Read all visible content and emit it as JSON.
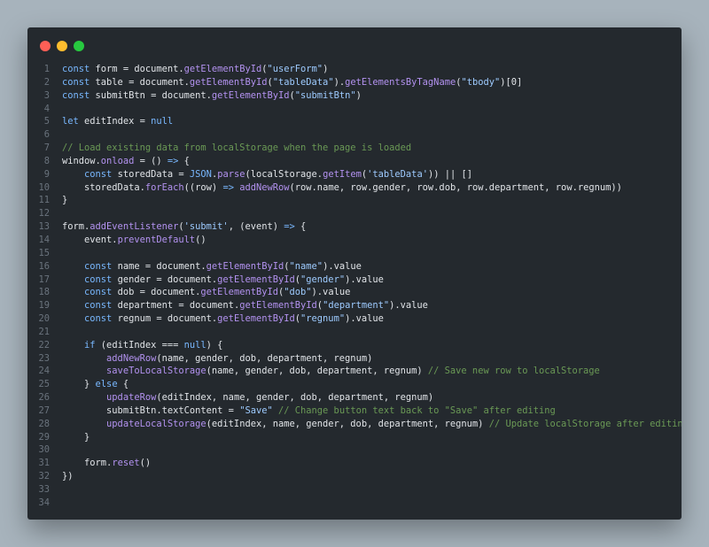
{
  "window": {
    "buttons": [
      "close",
      "minimize",
      "maximize"
    ],
    "colors": {
      "close": "#ff5f56",
      "minimize": "#ffbd2e",
      "maximize": "#27c93f",
      "background": "#24292e",
      "page_background": "#a7b3bc"
    }
  },
  "editor": {
    "language": "javascript",
    "lines": [
      [
        {
          "t": "const",
          "c": "kw"
        },
        {
          "t": " form = document.",
          "c": "pl"
        },
        {
          "t": "getElementById",
          "c": "fn"
        },
        {
          "t": "(",
          "c": "pl"
        },
        {
          "t": "\"userForm\"",
          "c": "str"
        },
        {
          "t": ")",
          "c": "pl"
        }
      ],
      [
        {
          "t": "const",
          "c": "kw"
        },
        {
          "t": " table = document.",
          "c": "pl"
        },
        {
          "t": "getElementById",
          "c": "fn"
        },
        {
          "t": "(",
          "c": "pl"
        },
        {
          "t": "\"tableData\"",
          "c": "str"
        },
        {
          "t": ").",
          "c": "pl"
        },
        {
          "t": "getElementsByTagName",
          "c": "fn"
        },
        {
          "t": "(",
          "c": "pl"
        },
        {
          "t": "\"tbody\"",
          "c": "str"
        },
        {
          "t": ")[0]",
          "c": "pl"
        }
      ],
      [
        {
          "t": "const",
          "c": "kw"
        },
        {
          "t": " submitBtn = document.",
          "c": "pl"
        },
        {
          "t": "getElementById",
          "c": "fn"
        },
        {
          "t": "(",
          "c": "pl"
        },
        {
          "t": "\"submitBtn\"",
          "c": "str"
        },
        {
          "t": ")",
          "c": "pl"
        }
      ],
      [],
      [
        {
          "t": "let",
          "c": "kw"
        },
        {
          "t": " editIndex = ",
          "c": "pl"
        },
        {
          "t": "null",
          "c": "kw"
        }
      ],
      [],
      [
        {
          "t": "// Load existing data from localStorage when the page is loaded",
          "c": "cm"
        }
      ],
      [
        {
          "t": "window.",
          "c": "pl"
        },
        {
          "t": "onload",
          "c": "fn"
        },
        {
          "t": " = () ",
          "c": "pl"
        },
        {
          "t": "=>",
          "c": "kw"
        },
        {
          "t": " {",
          "c": "pl"
        }
      ],
      [
        {
          "t": "    ",
          "c": "pl"
        },
        {
          "t": "const",
          "c": "kw"
        },
        {
          "t": " storedData = ",
          "c": "pl"
        },
        {
          "t": "JSON",
          "c": "kw"
        },
        {
          "t": ".",
          "c": "pl"
        },
        {
          "t": "parse",
          "c": "fn"
        },
        {
          "t": "(localStorage.",
          "c": "pl"
        },
        {
          "t": "getItem",
          "c": "fn"
        },
        {
          "t": "(",
          "c": "pl"
        },
        {
          "t": "'tableData'",
          "c": "str"
        },
        {
          "t": ")) || []",
          "c": "pl"
        }
      ],
      [
        {
          "t": "    storedData.",
          "c": "pl"
        },
        {
          "t": "forEach",
          "c": "fn"
        },
        {
          "t": "((row) ",
          "c": "pl"
        },
        {
          "t": "=>",
          "c": "kw"
        },
        {
          "t": " ",
          "c": "pl"
        },
        {
          "t": "addNewRow",
          "c": "fn"
        },
        {
          "t": "(row.name, row.gender, row.dob, row.department, row.regnum))",
          "c": "pl"
        }
      ],
      [
        {
          "t": "}",
          "c": "pl"
        }
      ],
      [],
      [
        {
          "t": "form.",
          "c": "pl"
        },
        {
          "t": "addEventListener",
          "c": "fn"
        },
        {
          "t": "(",
          "c": "pl"
        },
        {
          "t": "'submit'",
          "c": "str"
        },
        {
          "t": ", (event) ",
          "c": "pl"
        },
        {
          "t": "=>",
          "c": "kw"
        },
        {
          "t": " {",
          "c": "pl"
        }
      ],
      [
        {
          "t": "    event.",
          "c": "pl"
        },
        {
          "t": "preventDefault",
          "c": "fn"
        },
        {
          "t": "()",
          "c": "pl"
        }
      ],
      [],
      [
        {
          "t": "    ",
          "c": "pl"
        },
        {
          "t": "const",
          "c": "kw"
        },
        {
          "t": " name = document.",
          "c": "pl"
        },
        {
          "t": "getElementById",
          "c": "fn"
        },
        {
          "t": "(",
          "c": "pl"
        },
        {
          "t": "\"name\"",
          "c": "str"
        },
        {
          "t": ").value",
          "c": "pl"
        }
      ],
      [
        {
          "t": "    ",
          "c": "pl"
        },
        {
          "t": "const",
          "c": "kw"
        },
        {
          "t": " gender = document.",
          "c": "pl"
        },
        {
          "t": "getElementById",
          "c": "fn"
        },
        {
          "t": "(",
          "c": "pl"
        },
        {
          "t": "\"gender\"",
          "c": "str"
        },
        {
          "t": ").value",
          "c": "pl"
        }
      ],
      [
        {
          "t": "    ",
          "c": "pl"
        },
        {
          "t": "const",
          "c": "kw"
        },
        {
          "t": " dob = document.",
          "c": "pl"
        },
        {
          "t": "getElementById",
          "c": "fn"
        },
        {
          "t": "(",
          "c": "pl"
        },
        {
          "t": "\"dob\"",
          "c": "str"
        },
        {
          "t": ").value",
          "c": "pl"
        }
      ],
      [
        {
          "t": "    ",
          "c": "pl"
        },
        {
          "t": "const",
          "c": "kw"
        },
        {
          "t": " department = document.",
          "c": "pl"
        },
        {
          "t": "getElementById",
          "c": "fn"
        },
        {
          "t": "(",
          "c": "pl"
        },
        {
          "t": "\"department\"",
          "c": "str"
        },
        {
          "t": ").value",
          "c": "pl"
        }
      ],
      [
        {
          "t": "    ",
          "c": "pl"
        },
        {
          "t": "const",
          "c": "kw"
        },
        {
          "t": " regnum = document.",
          "c": "pl"
        },
        {
          "t": "getElementById",
          "c": "fn"
        },
        {
          "t": "(",
          "c": "pl"
        },
        {
          "t": "\"regnum\"",
          "c": "str"
        },
        {
          "t": ").value",
          "c": "pl"
        }
      ],
      [],
      [
        {
          "t": "    ",
          "c": "pl"
        },
        {
          "t": "if",
          "c": "kw"
        },
        {
          "t": " (editIndex === ",
          "c": "pl"
        },
        {
          "t": "null",
          "c": "kw"
        },
        {
          "t": ") {",
          "c": "pl"
        }
      ],
      [
        {
          "t": "        ",
          "c": "pl"
        },
        {
          "t": "addNewRow",
          "c": "fn"
        },
        {
          "t": "(name, gender, dob, department, regnum)",
          "c": "pl"
        }
      ],
      [
        {
          "t": "        ",
          "c": "pl"
        },
        {
          "t": "saveToLocalStorage",
          "c": "fn"
        },
        {
          "t": "(name, gender, dob, department, regnum) ",
          "c": "pl"
        },
        {
          "t": "// Save new row to localStorage",
          "c": "cm"
        }
      ],
      [
        {
          "t": "    } ",
          "c": "pl"
        },
        {
          "t": "else",
          "c": "kw"
        },
        {
          "t": " {",
          "c": "pl"
        }
      ],
      [
        {
          "t": "        ",
          "c": "pl"
        },
        {
          "t": "updateRow",
          "c": "fn"
        },
        {
          "t": "(editIndex, name, gender, dob, department, regnum)",
          "c": "pl"
        }
      ],
      [
        {
          "t": "        submitBtn.textContent = ",
          "c": "pl"
        },
        {
          "t": "\"Save\"",
          "c": "str"
        },
        {
          "t": " ",
          "c": "pl"
        },
        {
          "t": "// Change button text back to \"Save\" after editing",
          "c": "cm"
        }
      ],
      [
        {
          "t": "        ",
          "c": "pl"
        },
        {
          "t": "updateLocalStorage",
          "c": "fn"
        },
        {
          "t": "(editIndex, name, gender, dob, department, regnum) ",
          "c": "pl"
        },
        {
          "t": "// Update localStorage after editing",
          "c": "cm"
        }
      ],
      [
        {
          "t": "    }",
          "c": "pl"
        }
      ],
      [],
      [
        {
          "t": "    form.",
          "c": "pl"
        },
        {
          "t": "reset",
          "c": "fn"
        },
        {
          "t": "()",
          "c": "pl"
        }
      ],
      [
        {
          "t": "})",
          "c": "pl"
        }
      ],
      [],
      []
    ]
  }
}
